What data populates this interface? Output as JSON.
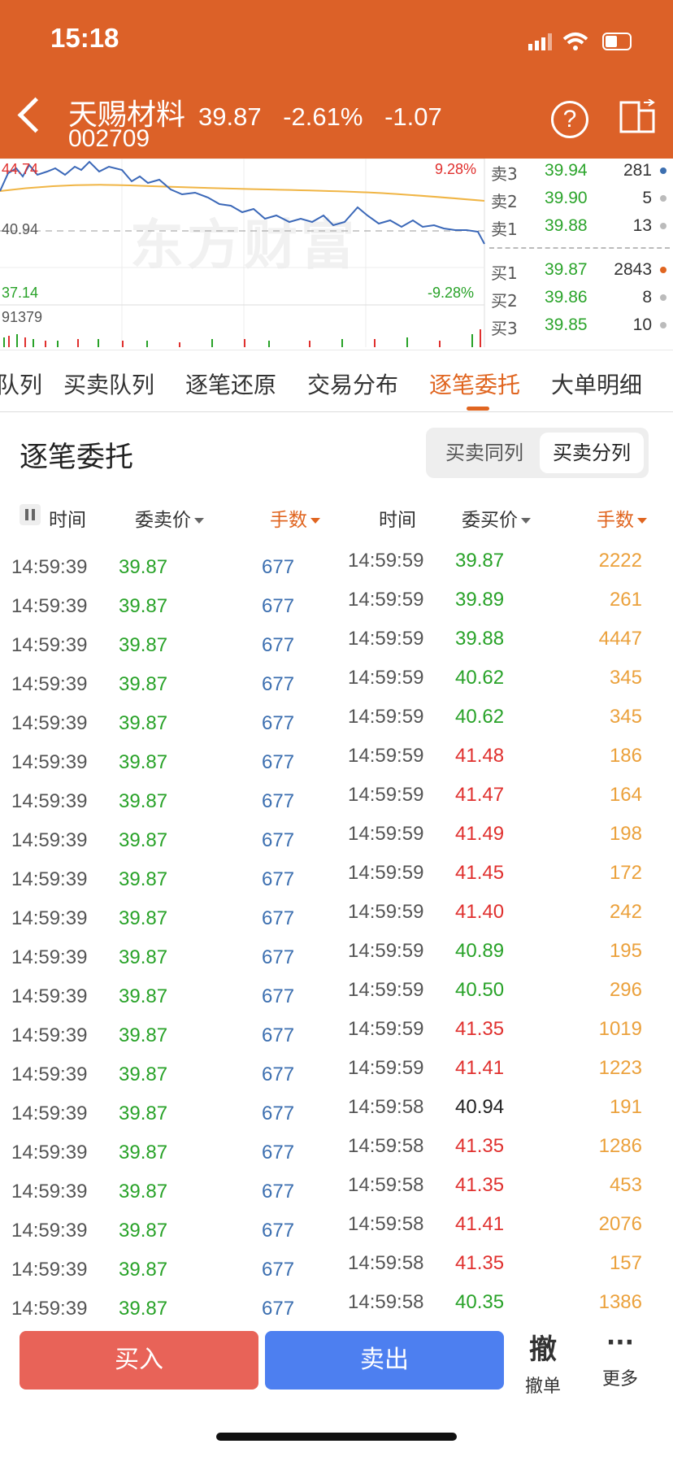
{
  "status": {
    "time": "15:18"
  },
  "stock": {
    "name": "天赐材料",
    "code": "002709",
    "price": "39.87",
    "change_pct": "-2.61%",
    "change": "-1.07"
  },
  "chart": {
    "high_label": "44.74",
    "high_pct": "9.28%",
    "mid_label": "40.94",
    "low_label": "37.14",
    "low_pct": "-9.28%",
    "volume_label": "91379",
    "watermark": "东方财富"
  },
  "orderbook": {
    "sell": [
      {
        "label": "卖3",
        "price": "39.94",
        "qty": "281",
        "dot": "#3c6fb0"
      },
      {
        "label": "卖2",
        "price": "39.90",
        "qty": "5",
        "dot": "#bbbbbb"
      },
      {
        "label": "卖1",
        "price": "39.88",
        "qty": "13",
        "dot": "#bbbbbb"
      }
    ],
    "buy": [
      {
        "label": "买1",
        "price": "39.87",
        "qty": "2843",
        "dot": "#e06520"
      },
      {
        "label": "买2",
        "price": "39.86",
        "qty": "8",
        "dot": "#bbbbbb"
      },
      {
        "label": "买3",
        "price": "39.85",
        "qty": "10",
        "dot": "#bbbbbb"
      }
    ]
  },
  "tabs": [
    "队列",
    "买卖队列",
    "逐笔还原",
    "交易分布",
    "逐笔委托",
    "大单明细"
  ],
  "active_tab": "逐笔委托",
  "section": {
    "title": "逐笔委托",
    "toggle": [
      "买卖同列",
      "买卖分列"
    ]
  },
  "columns": {
    "sell_time": "时间",
    "sell_price": "委卖价",
    "sell_qty": "手数",
    "buy_time": "时间",
    "buy_price": "委买价",
    "buy_qty": "手数"
  },
  "sell_rows": [
    {
      "time": "14:59:39",
      "price": "39.87",
      "qty": "677"
    },
    {
      "time": "14:59:39",
      "price": "39.87",
      "qty": "677"
    },
    {
      "time": "14:59:39",
      "price": "39.87",
      "qty": "677"
    },
    {
      "time": "14:59:39",
      "price": "39.87",
      "qty": "677"
    },
    {
      "time": "14:59:39",
      "price": "39.87",
      "qty": "677"
    },
    {
      "time": "14:59:39",
      "price": "39.87",
      "qty": "677"
    },
    {
      "time": "14:59:39",
      "price": "39.87",
      "qty": "677"
    },
    {
      "time": "14:59:39",
      "price": "39.87",
      "qty": "677"
    },
    {
      "time": "14:59:39",
      "price": "39.87",
      "qty": "677"
    },
    {
      "time": "14:59:39",
      "price": "39.87",
      "qty": "677"
    },
    {
      "time": "14:59:39",
      "price": "39.87",
      "qty": "677"
    },
    {
      "time": "14:59:39",
      "price": "39.87",
      "qty": "677"
    },
    {
      "time": "14:59:39",
      "price": "39.87",
      "qty": "677"
    },
    {
      "time": "14:59:39",
      "price": "39.87",
      "qty": "677"
    },
    {
      "time": "14:59:39",
      "price": "39.87",
      "qty": "677"
    },
    {
      "time": "14:59:39",
      "price": "39.87",
      "qty": "677"
    },
    {
      "time": "14:59:39",
      "price": "39.87",
      "qty": "677"
    },
    {
      "time": "14:59:39",
      "price": "39.87",
      "qty": "677"
    },
    {
      "time": "14:59:39",
      "price": "39.87",
      "qty": "677"
    },
    {
      "time": "14:59:39",
      "price": "39.87",
      "qty": "677"
    }
  ],
  "buy_rows": [
    {
      "time": "14:59:59",
      "price": "39.87",
      "qty": "2222",
      "color": "green"
    },
    {
      "time": "14:59:59",
      "price": "39.89",
      "qty": "261",
      "color": "green"
    },
    {
      "time": "14:59:59",
      "price": "39.88",
      "qty": "4447",
      "color": "green"
    },
    {
      "time": "14:59:59",
      "price": "40.62",
      "qty": "345",
      "color": "green"
    },
    {
      "time": "14:59:59",
      "price": "40.62",
      "qty": "345",
      "color": "green"
    },
    {
      "time": "14:59:59",
      "price": "41.48",
      "qty": "186",
      "color": "red"
    },
    {
      "time": "14:59:59",
      "price": "41.47",
      "qty": "164",
      "color": "red"
    },
    {
      "time": "14:59:59",
      "price": "41.49",
      "qty": "198",
      "color": "red"
    },
    {
      "time": "14:59:59",
      "price": "41.45",
      "qty": "172",
      "color": "red"
    },
    {
      "time": "14:59:59",
      "price": "41.40",
      "qty": "242",
      "color": "red"
    },
    {
      "time": "14:59:59",
      "price": "40.89",
      "qty": "195",
      "color": "green"
    },
    {
      "time": "14:59:59",
      "price": "40.50",
      "qty": "296",
      "color": "green"
    },
    {
      "time": "14:59:59",
      "price": "41.35",
      "qty": "1019",
      "color": "red"
    },
    {
      "time": "14:59:59",
      "price": "41.41",
      "qty": "1223",
      "color": "red"
    },
    {
      "time": "14:59:58",
      "price": "40.94",
      "qty": "191",
      "color": "black"
    },
    {
      "time": "14:59:58",
      "price": "41.35",
      "qty": "1286",
      "color": "red"
    },
    {
      "time": "14:59:58",
      "price": "41.35",
      "qty": "453",
      "color": "red"
    },
    {
      "time": "14:59:58",
      "price": "41.41",
      "qty": "2076",
      "color": "red"
    },
    {
      "time": "14:59:58",
      "price": "41.35",
      "qty": "157",
      "color": "red"
    },
    {
      "time": "14:59:58",
      "price": "40.35",
      "qty": "1386",
      "color": "green"
    }
  ],
  "actions": {
    "buy": "买入",
    "sell": "卖出",
    "cancel_glyph": "撤",
    "cancel": "撤单",
    "more_glyph": "···",
    "more": "更多"
  }
}
